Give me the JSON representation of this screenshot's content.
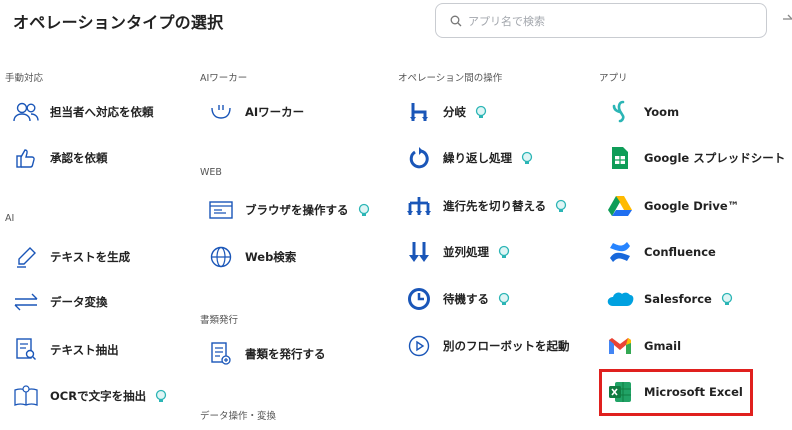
{
  "header": {
    "title": "オペレーションタイプの選択",
    "search_placeholder": "アプリ名で検索"
  },
  "columns": {
    "manual": {
      "section": "手動対応",
      "items": [
        {
          "label": "担当者へ対応を依頼",
          "icon": "people-icon"
        },
        {
          "label": "承認を依頼",
          "icon": "thumbs-up-icon"
        }
      ]
    },
    "ai": {
      "section": "AI",
      "items": [
        {
          "label": "テキストを生成",
          "icon": "pen-icon"
        },
        {
          "label": "データ変換",
          "icon": "convert-arrows-icon"
        },
        {
          "label": "テキスト抽出",
          "icon": "document-search-icon"
        },
        {
          "label": "OCRで文字を抽出",
          "icon": "ocr-book-icon",
          "badge": true
        }
      ]
    },
    "aiworker": {
      "section": "AIワーカー",
      "items": [
        {
          "label": "AIワーカー",
          "icon": "ai-smile-icon"
        }
      ]
    },
    "web": {
      "section": "WEB",
      "items": [
        {
          "label": "ブラウザを操作する",
          "icon": "browser-icon",
          "badge": true
        },
        {
          "label": "Web検索",
          "icon": "globe-icon"
        }
      ]
    },
    "docs": {
      "section": "書類発行",
      "items": [
        {
          "label": "書類を発行する",
          "icon": "document-add-icon"
        }
      ]
    },
    "data_ops": {
      "section": "データ操作・変換"
    },
    "operations": {
      "section": "オペレーション間の操作",
      "items": [
        {
          "label": "分岐",
          "icon": "branch-icon",
          "badge": true
        },
        {
          "label": "繰り返し処理",
          "icon": "loop-icon",
          "badge": true
        },
        {
          "label": "進行先を切り替える",
          "icon": "switch-icon",
          "badge": true
        },
        {
          "label": "並列処理",
          "icon": "parallel-icon",
          "badge": true
        },
        {
          "label": "待機する",
          "icon": "clock-icon",
          "badge": true
        },
        {
          "label": "別のフローボットを起動",
          "icon": "play-circle-icon"
        }
      ]
    },
    "apps": {
      "section": "アプリ",
      "items": [
        {
          "label": "Yoom",
          "icon": "yoom-logo-icon"
        },
        {
          "label": "Google スプレッドシート",
          "icon": "google-sheets-icon"
        },
        {
          "label": "Google Drive™",
          "icon": "google-drive-icon"
        },
        {
          "label": "Confluence",
          "icon": "confluence-icon"
        },
        {
          "label": "Salesforce",
          "icon": "salesforce-icon",
          "badge": true
        },
        {
          "label": "Gmail",
          "icon": "gmail-icon"
        },
        {
          "label": "Microsoft Excel",
          "icon": "excel-icon"
        }
      ]
    }
  },
  "colors": {
    "accent_blue": "#1a56b8",
    "badge_teal": "#2bb5b5",
    "highlight_red": "#e0201e"
  }
}
